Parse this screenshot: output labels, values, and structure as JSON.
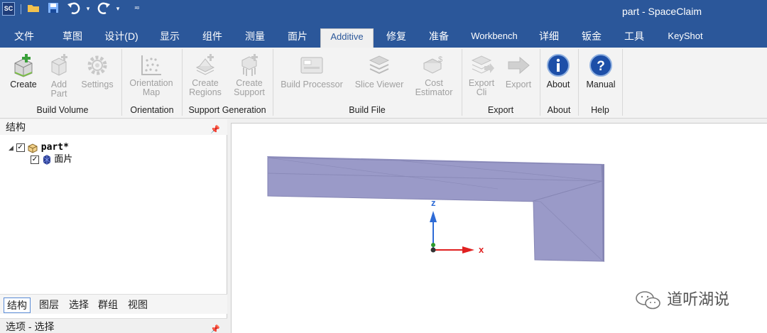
{
  "app": {
    "logo_text": "SC",
    "window_title": "part - SpaceClaim"
  },
  "tabs": [
    {
      "label": "文件"
    },
    {
      "label": "草图"
    },
    {
      "label": "设计(D)"
    },
    {
      "label": "显示"
    },
    {
      "label": "组件"
    },
    {
      "label": "测量"
    },
    {
      "label": "面片"
    },
    {
      "label": "Additive"
    },
    {
      "label": "修复"
    },
    {
      "label": "准备"
    },
    {
      "label": "Workbench"
    },
    {
      "label": "详细"
    },
    {
      "label": "钣金"
    },
    {
      "label": "工具"
    },
    {
      "label": "KeyShot"
    }
  ],
  "active_tab": "Additive",
  "ribbon": {
    "buttons": [
      {
        "label": "Create",
        "icon": "create-build-volume-icon",
        "enabled": true
      },
      {
        "label": "Add\nPart",
        "icon": "add-part-icon",
        "enabled": false
      },
      {
        "label": "Settings",
        "icon": "settings-gear-icon",
        "enabled": false
      },
      {
        "label": "Orientation\nMap",
        "icon": "orientation-map-icon",
        "enabled": false
      },
      {
        "label": "Create\nRegions",
        "icon": "create-regions-icon",
        "enabled": false
      },
      {
        "label": "Create\nSupport",
        "icon": "create-support-icon",
        "enabled": false
      },
      {
        "label": "Build Processor",
        "icon": "build-processor-icon",
        "enabled": false
      },
      {
        "label": "Slice Viewer",
        "icon": "slice-viewer-icon",
        "enabled": false
      },
      {
        "label": "Cost\nEstimator",
        "icon": "cost-estimator-icon",
        "enabled": false
      },
      {
        "label": "Export\nCli",
        "icon": "export-cli-icon",
        "enabled": false
      },
      {
        "label": "Export",
        "icon": "export-arrow-icon",
        "enabled": false
      },
      {
        "label": "About",
        "icon": "info-icon",
        "enabled": true
      },
      {
        "label": "Manual",
        "icon": "help-icon",
        "enabled": true
      }
    ],
    "groups": [
      {
        "label": "Build Volume"
      },
      {
        "label": "Orientation"
      },
      {
        "label": "Support Generation"
      },
      {
        "label": "Build File"
      },
      {
        "label": "Export"
      },
      {
        "label": "About"
      },
      {
        "label": "Help"
      }
    ]
  },
  "structure_panel": {
    "title": "结构",
    "tree": [
      {
        "label": "part*",
        "checked": true,
        "expanded": true
      },
      {
        "label": "面片",
        "checked": true
      }
    ],
    "bottom_tabs": [
      {
        "label": "结构"
      },
      {
        "label": "图层"
      },
      {
        "label": "选择"
      },
      {
        "label": "群组"
      },
      {
        "label": "视图"
      }
    ],
    "options_title": "选项 - 选择"
  },
  "viewport": {
    "axis_z": "z",
    "axis_x": "x",
    "model_color": "#9a9ac8"
  },
  "watermark": {
    "text": "道听湖说"
  },
  "colors": {
    "title_bar": "#2b579a",
    "accent": "#2b579a"
  }
}
